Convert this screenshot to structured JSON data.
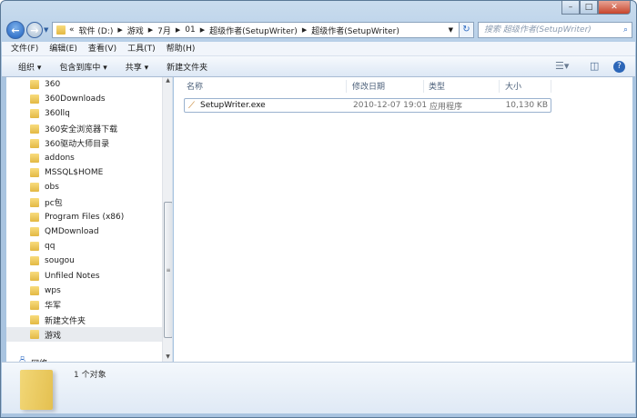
{
  "address": {
    "crumbs": [
      "«",
      "软件 (D:)",
      "游戏",
      "7月",
      "01",
      "超级作者(SetupWriter)",
      "超级作者(SetupWriter)"
    ]
  },
  "search": {
    "placeholder": "搜索 超级作者(SetupWriter)"
  },
  "menu": [
    "文件(F)",
    "编辑(E)",
    "查看(V)",
    "工具(T)",
    "帮助(H)"
  ],
  "toolbar": {
    "organize": "组织 ▾",
    "include": "包含到库中 ▾",
    "share": "共享 ▾",
    "new_folder": "新建文件夹"
  },
  "tree": [
    "360",
    "360Downloads",
    "360llq",
    "360安全浏览器下载",
    "360驱动大师目录",
    "addons",
    "MSSQL$HOME",
    "obs",
    "pc包",
    "Program Files (x86)",
    "QMDownload",
    "qq",
    "sougou",
    "Unfiled Notes",
    "wps",
    "华军",
    "新建文件夹",
    "游戏"
  ],
  "tree_network": "网络",
  "columns": [
    "名称",
    "修改日期",
    "类型",
    "大小"
  ],
  "files": [
    {
      "name": "SetupWriter.exe",
      "modified": "2010-12-07 19:01",
      "type": "应用程序",
      "size": "10,130 KB"
    }
  ],
  "status": "1 个对象"
}
